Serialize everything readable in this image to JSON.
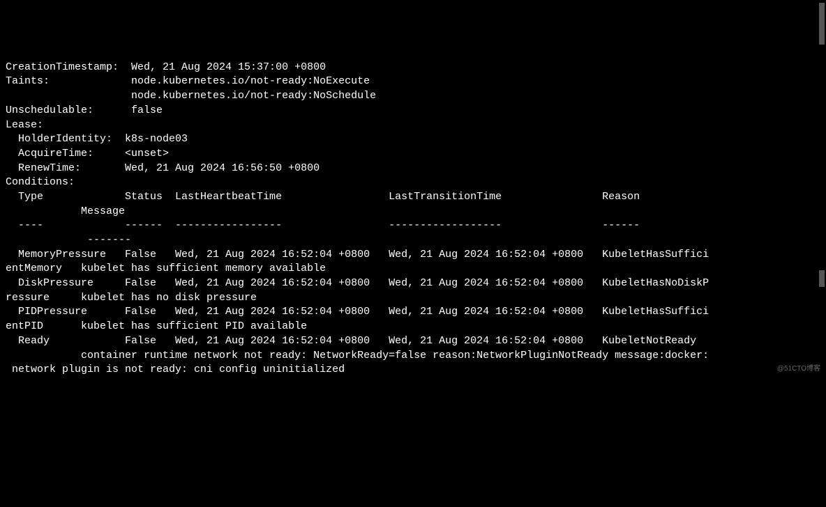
{
  "lines": {
    "l1": "CreationTimestamp:  Wed, 21 Aug 2024 15:37:00 +0800",
    "l2": "Taints:             node.kubernetes.io/not-ready:NoExecute",
    "l3": "                    node.kubernetes.io/not-ready:NoSchedule",
    "l4": "Unschedulable:      false",
    "l5": "Lease:",
    "l6": "  HolderIdentity:  k8s-node03",
    "l7": "  AcquireTime:     <unset>",
    "l8": "  RenewTime:       Wed, 21 Aug 2024 16:56:50 +0800",
    "l9": "Conditions:",
    "l10": "  Type             Status  LastHeartbeatTime                 LastTransitionTime                Reason",
    "l11": "            Message",
    "l12": "  ----             ------  -----------------                 ------------------                ------",
    "l13": "             -------",
    "l14": "  MemoryPressure   False   Wed, 21 Aug 2024 16:52:04 +0800   Wed, 21 Aug 2024 16:52:04 +0800   KubeletHasSuffici",
    "l15": "entMemory   kubelet has sufficient memory available",
    "l16": "  DiskPressure     False   Wed, 21 Aug 2024 16:52:04 +0800   Wed, 21 Aug 2024 16:52:04 +0800   KubeletHasNoDiskP",
    "l17": "ressure     kubelet has no disk pressure",
    "l18": "  PIDPressure      False   Wed, 21 Aug 2024 16:52:04 +0800   Wed, 21 Aug 2024 16:52:04 +0800   KubeletHasSuffici",
    "l19": "entPID      kubelet has sufficient PID available",
    "l20": "  Ready            False   Wed, 21 Aug 2024 16:52:04 +0800   Wed, 21 Aug 2024 16:52:04 +0800   KubeletNotReady",
    "l21": "            container runtime network not ready: NetworkReady=false reason:NetworkPluginNotReady message:docker:",
    "l22": " network plugin is not ready: cni config uninitialized"
  },
  "watermark": "@51CTO博客"
}
